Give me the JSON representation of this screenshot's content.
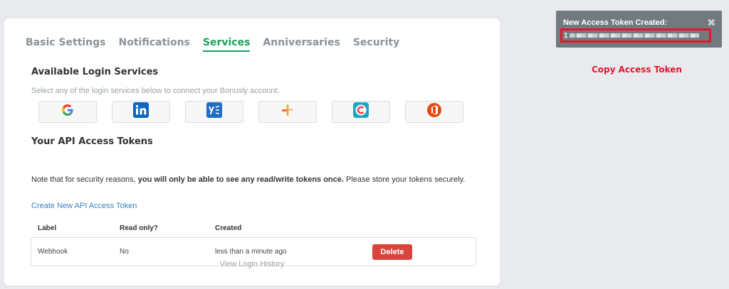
{
  "tabs": [
    {
      "label": "Basic Settings",
      "active": false
    },
    {
      "label": "Notifications",
      "active": false
    },
    {
      "label": "Services",
      "active": true
    },
    {
      "label": "Anniversaries",
      "active": false
    },
    {
      "label": "Security",
      "active": false
    }
  ],
  "login_services": {
    "heading": "Available Login Services",
    "subtext": "Select any of the login services below to connect your Bonusly account.",
    "services": [
      {
        "name": "google-icon"
      },
      {
        "name": "linkedin-icon"
      },
      {
        "name": "yammer-icon"
      },
      {
        "name": "slack-icon"
      },
      {
        "name": "citrix-icon"
      },
      {
        "name": "office365-icon"
      }
    ]
  },
  "tokens": {
    "heading": "Your API Access Tokens",
    "note_prefix": "Note that for security reasons, ",
    "note_bold": "you will only be able to see any read/write tokens once.",
    "note_suffix": " Please store your tokens securely.",
    "create_link": "Create New API Access Token",
    "columns": [
      "Label",
      "Read only?",
      "Created"
    ],
    "rows": [
      {
        "label": "Webhook",
        "read_only": "No",
        "created": "less than a minute ago",
        "action": "Delete"
      }
    ],
    "history_link": "View Login History"
  },
  "toast": {
    "title": "New Access Token Created:",
    "token_visible": "1",
    "close": "✖"
  },
  "annotation": "Copy Access Token",
  "colors": {
    "accent": "#17a35a",
    "danger": "#d9443d",
    "highlight": "#e3162d",
    "link": "#3a7fc1"
  }
}
